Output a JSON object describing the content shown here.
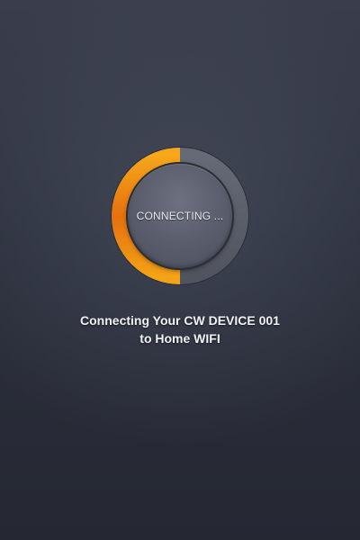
{
  "connect": {
    "status_label": "CONNECTING ...",
    "message_line1": "Connecting Your CW DEVICE 001",
    "message_line2": "to Home WIFI",
    "progress_fraction": 0.5
  },
  "colors": {
    "progress_orange": "#f39a12",
    "progress_orange_dark": "#e36c0f",
    "track_gray": "#5a5e6a",
    "background": "#2f3340"
  }
}
